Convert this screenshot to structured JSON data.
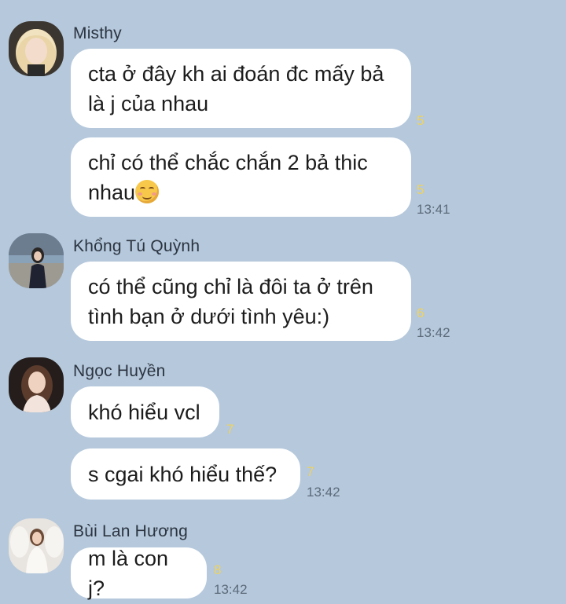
{
  "colors": {
    "background": "#b5c8dc",
    "bubble": "#ffffff",
    "read_count": "#f0d35a",
    "timestamp": "#5d6b7a"
  },
  "messages": [
    {
      "sender": "Misthy",
      "avatar_icon": "user-avatar-blonde-hair",
      "bubbles": [
        {
          "text": "cta ở đây kh ai đoán đc mấy bả\nlà j của nhau",
          "count": "5"
        },
        {
          "text": "chỉ có thể chắc chắn 2 bả thic\nnhau",
          "emoji": "smiling-face-icon",
          "count": "5",
          "time": "13:41"
        }
      ]
    },
    {
      "sender": "Khổng Tú Quỳnh",
      "avatar_icon": "user-avatar-outdoor-photo",
      "bubbles": [
        {
          "text": "có thể cũng chỉ là đôi ta ở trên\ntình bạn ở dưới tình yêu:)",
          "count": "6",
          "time": "13:42"
        }
      ]
    },
    {
      "sender": "Ngọc Huyền",
      "avatar_icon": "user-avatar-dark-hair",
      "bubbles": [
        {
          "text": "khó hiểu vcl",
          "count": "7"
        },
        {
          "text": "s cgai khó hiểu thế?",
          "count": "7",
          "time": "13:42"
        }
      ]
    },
    {
      "sender": "Bùi Lan Hương",
      "avatar_icon": "user-avatar-white-dress",
      "bubbles": [
        {
          "text": "m là con j?",
          "count": "8",
          "time": "13:42"
        }
      ]
    }
  ]
}
